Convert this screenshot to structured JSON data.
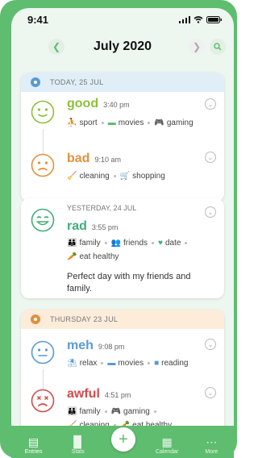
{
  "status_bar": {
    "time": "9:41"
  },
  "header": {
    "title": "July 2020"
  },
  "colors": {
    "accent": "#5fbd6f",
    "good": "#8dbf3a",
    "bad": "#e0913d",
    "rad": "#3fae78",
    "meh": "#5a9ad2",
    "awful": "#d24b4b"
  },
  "days": [
    {
      "date": "TODAY, 25 JUL",
      "entries": [
        {
          "mood": "good",
          "time": "3:40 pm",
          "tags": [
            "sport",
            "movies",
            "gaming"
          ]
        },
        {
          "mood": "bad",
          "time": "9:10 am",
          "tags": [
            "cleaning",
            "shopping"
          ]
        }
      ]
    },
    {
      "date": "YESTERDAY, 24 JUL",
      "entries": [
        {
          "mood": "rad",
          "time": "3:55 pm",
          "tags": [
            "family",
            "friends",
            "date",
            "eat healthy"
          ],
          "note": "Perfect day with my friends and family."
        }
      ]
    },
    {
      "date": "THURSDAY 23 JUL",
      "entries": [
        {
          "mood": "meh",
          "time": "9:08 pm",
          "tags": [
            "relax",
            "movies",
            "reading"
          ]
        },
        {
          "mood": "awful",
          "time": "4:51 pm",
          "tags": [
            "family",
            "gaming",
            "cleaning",
            "eat healthy"
          ]
        }
      ]
    }
  ],
  "tabbar": {
    "tabs": [
      "Entries",
      "Stats",
      "Calendar",
      "More"
    ]
  }
}
